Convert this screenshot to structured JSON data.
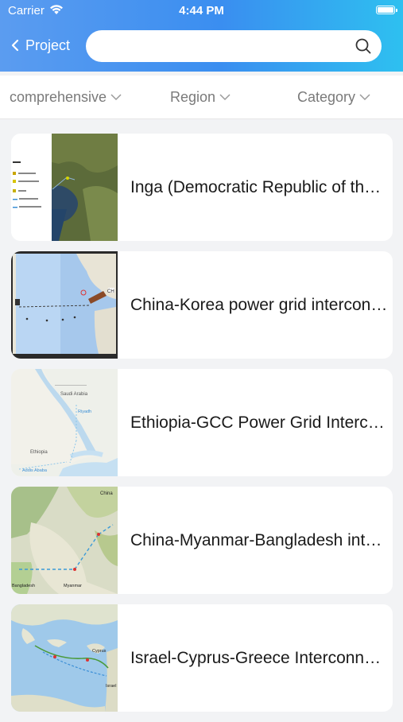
{
  "status_bar": {
    "carrier": "Carrier",
    "time": "4:44 PM"
  },
  "nav": {
    "back_label": "Project",
    "search_placeholder": "",
    "search_value": ""
  },
  "filters": [
    {
      "label": "comprehensive"
    },
    {
      "label": "Region"
    },
    {
      "label": "Category"
    }
  ],
  "projects": [
    {
      "title": "Inga (Democratic Republic of the Congo)"
    },
    {
      "title": "China-Korea power grid interconnection"
    },
    {
      "title": "Ethiopia-GCC Power Grid Interconnection"
    },
    {
      "title": "China-Myanmar-Bangladesh interconnection"
    },
    {
      "title": "Israel-Cyprus-Greece Interconnection"
    }
  ],
  "map_labels": {
    "card2": [
      "CH"
    ],
    "card3": [
      "Saudi Arabia",
      "Riyadh",
      "Ethiopia",
      "Addis Ababa"
    ],
    "card4": [
      "China",
      "Myanmar",
      "Bangladesh"
    ],
    "card5": [
      "Cyprus",
      "Israel"
    ]
  },
  "colors": {
    "header_start": "#5b9cf0",
    "header_end": "#2ec0f0",
    "background": "#f2f3f5"
  }
}
